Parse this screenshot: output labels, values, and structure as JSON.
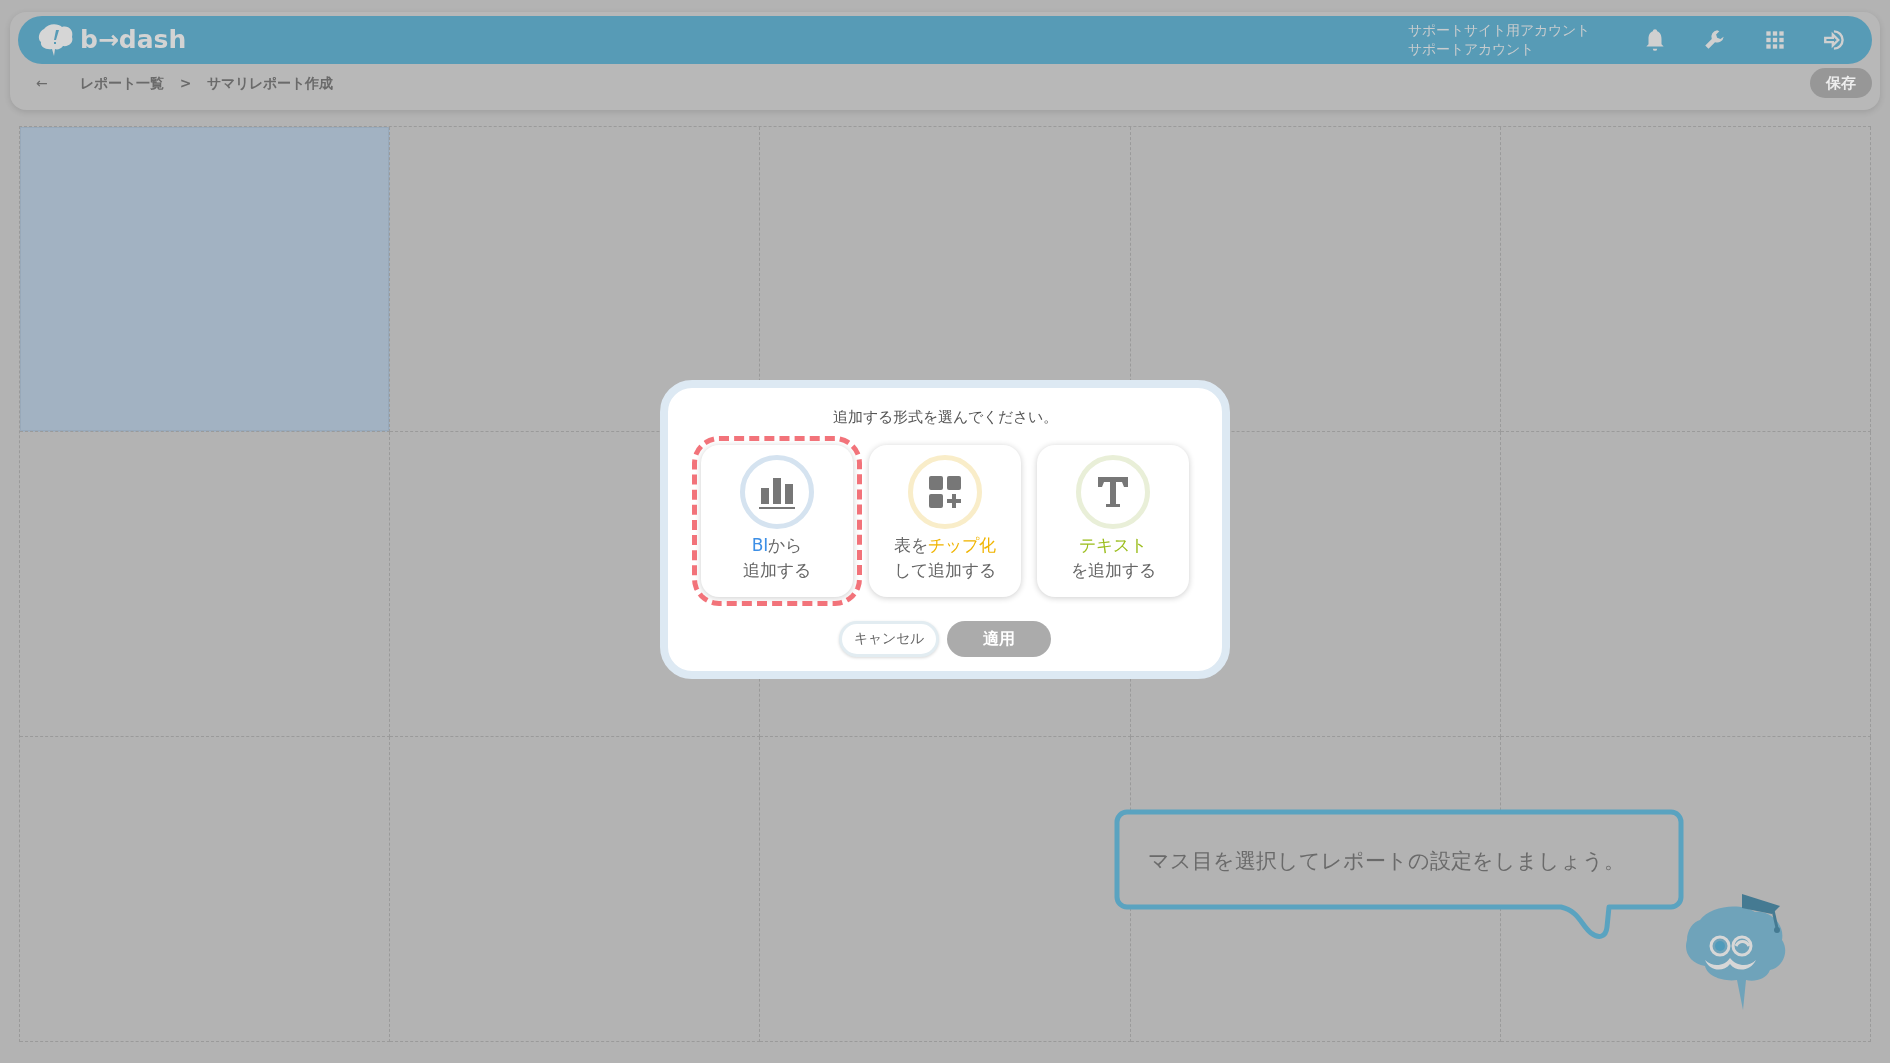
{
  "header": {
    "logo": "b→dash",
    "account": {
      "line_1": "サポートサイト用アカウント",
      "line_2": "サポートアカウント"
    }
  },
  "breadcrumb": {
    "back": "←",
    "items": [
      {
        "label": "レポート一覧"
      },
      {
        "label": "サマリレポート作成"
      }
    ],
    "separator": ">"
  },
  "save_button": {
    "label": "保存",
    "disabled": true
  },
  "grid_cells": [
    {
      "selected": true
    },
    {
      "selected": false
    },
    {
      "selected": false
    },
    {
      "selected": false
    },
    {
      "selected": false
    },
    {
      "selected": false
    },
    {
      "selected": false
    },
    {
      "selected": false
    },
    {
      "selected": false
    },
    {
      "selected": false
    },
    {
      "selected": false
    },
    {
      "selected": false
    },
    {
      "selected": false
    },
    {
      "selected": false
    },
    {
      "selected": false
    }
  ],
  "dialog": {
    "prompt": "追加する形式を選んでください。",
    "options": [
      {
        "kind": "bi",
        "selected": true,
        "color": "#3d8fe6",
        "lines": [
          [
            {
              "text": "BI",
              "accent": true
            },
            {
              "text": "から",
              "accent": false
            }
          ],
          [
            {
              "text": "追加する",
              "accent": false
            }
          ]
        ]
      },
      {
        "kind": "chip",
        "selected": false,
        "color": "#f0b400",
        "lines": [
          [
            {
              "text": "表を",
              "accent": false
            },
            {
              "text": "チップ化",
              "accent": true
            }
          ],
          [
            {
              "text": "して追加する",
              "accent": false
            }
          ]
        ]
      },
      {
        "kind": "text",
        "selected": false,
        "color": "#9cbe1e",
        "lines": [
          [
            {
              "text": "テキスト",
              "accent": true
            }
          ],
          [
            {
              "text": "を追加する",
              "accent": false
            }
          ]
        ]
      }
    ],
    "cancel": "キャンセル",
    "apply": {
      "label": "適用",
      "disabled": true
    }
  },
  "hint": "マス目を選択してレポートの設定をしましょう。"
}
